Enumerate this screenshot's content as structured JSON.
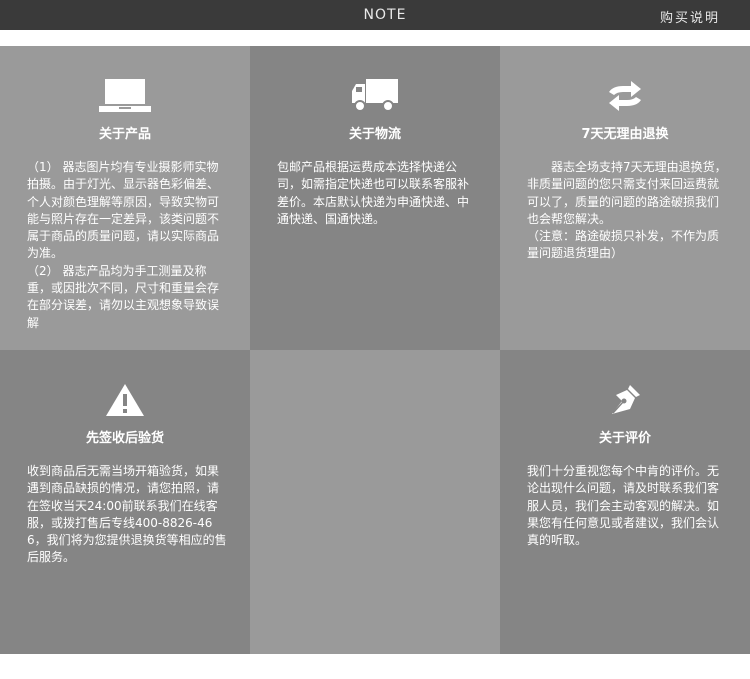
{
  "header": {
    "note": "NOTE",
    "purchase_info": "购买说明"
  },
  "cells": [
    {
      "icon": "laptop-icon",
      "title": "关于产品",
      "paragraphs": [
        "（1） 器志图片均有专业摄影师实物拍摄。由于灯光、显示器色彩偏差、个人对颜色理解等原因，导致实物可能与照片存在一定差异，该类问题不属于商品的质量问题，请以实际商品为准。",
        "（2） 器志产品均为手工测量及称重，或因批次不同，尺寸和重量会存在部分误差，请勿以主观想象导致误解"
      ]
    },
    {
      "icon": "truck-icon",
      "title": "关于物流",
      "paragraphs": [
        "包邮产品根据运费成本选择快递公司，如需指定快递也可以联系客服补差价。本店默认快递为申通快递、中通快递、国通快递。"
      ]
    },
    {
      "icon": "exchange-arrows-icon",
      "title": "7天无理由退换",
      "paragraphs": [
        "器志全场支持7天无理由退换货，非质量问题的您只需支付来回运费就可以了，质量的问题的路途破损我们也会帮您解决。",
        "（注意：路途破损只补发，不作为质量问题退货理由）"
      ]
    },
    {
      "icon": "warning-icon",
      "title": "先签收后验货",
      "paragraphs": [
        "收到商品后无需当场开箱验货，如果遇到商品缺损的情况，请您拍照，请在签收当天24:00前联系我们在线客服，或拨打售后专线400-8826-466，我们将为您提供退换货等相应的售后服务。"
      ]
    },
    {
      "icon": "",
      "title": "",
      "paragraphs": []
    },
    {
      "icon": "pen-nib-icon",
      "title": "关于评价",
      "paragraphs": [
        "我们十分重视您每个中肯的评价。无论出现什么问题，请及时联系我们客服人员，我们会主动客观的解决。如果您有任何意见或者建议，我们会认真的听取。"
      ]
    }
  ]
}
